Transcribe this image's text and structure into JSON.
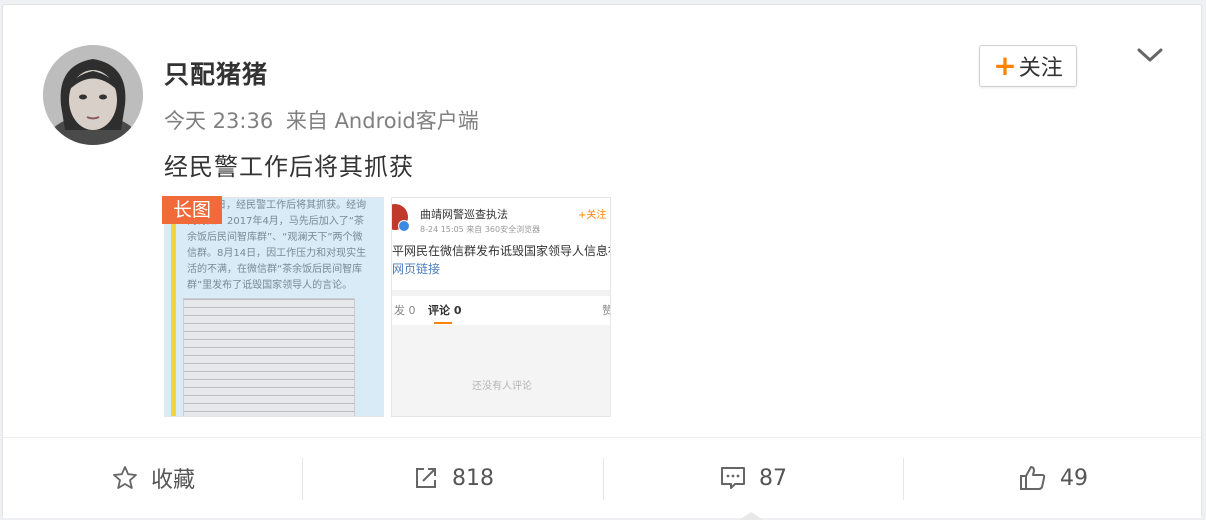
{
  "post": {
    "username": "只配猪猪",
    "time": "今天 23:36",
    "source": "来自 Android客户端",
    "text": "经民警工作后将其抓获",
    "follow_label": "关注"
  },
  "images": {
    "long_badge": "长图",
    "thumb1_text": "8月18日，经民警工作后将其抓获。经询问得知：2017年4月，马先后加入了“茶余饭后民间智库群”、“观澜天下”两个微信群。8月14日，因工作压力和对现实生活的不满，在微信群“茶余饭后民间智库群”里发布了诋毁国家领导人的言论。",
    "thumb2": {
      "account": "曲靖网警巡查执法",
      "time": "8-24 15:05  来自 360安全浏览器",
      "follow": "+关注",
      "title": "平网民在微信群发布诋毁国家领导人信息被",
      "link": "网页链接",
      "tab_repost": "发 0",
      "tab_comment": "评论 0",
      "tab_like": "赞",
      "empty": "还没有人评论"
    }
  },
  "actions": {
    "favorite": "收藏",
    "repost": "818",
    "comment": "87",
    "like": "49"
  },
  "colors": {
    "accent": "#ff8200",
    "badge": "#f06a3a",
    "link": "#4a7fbd"
  }
}
